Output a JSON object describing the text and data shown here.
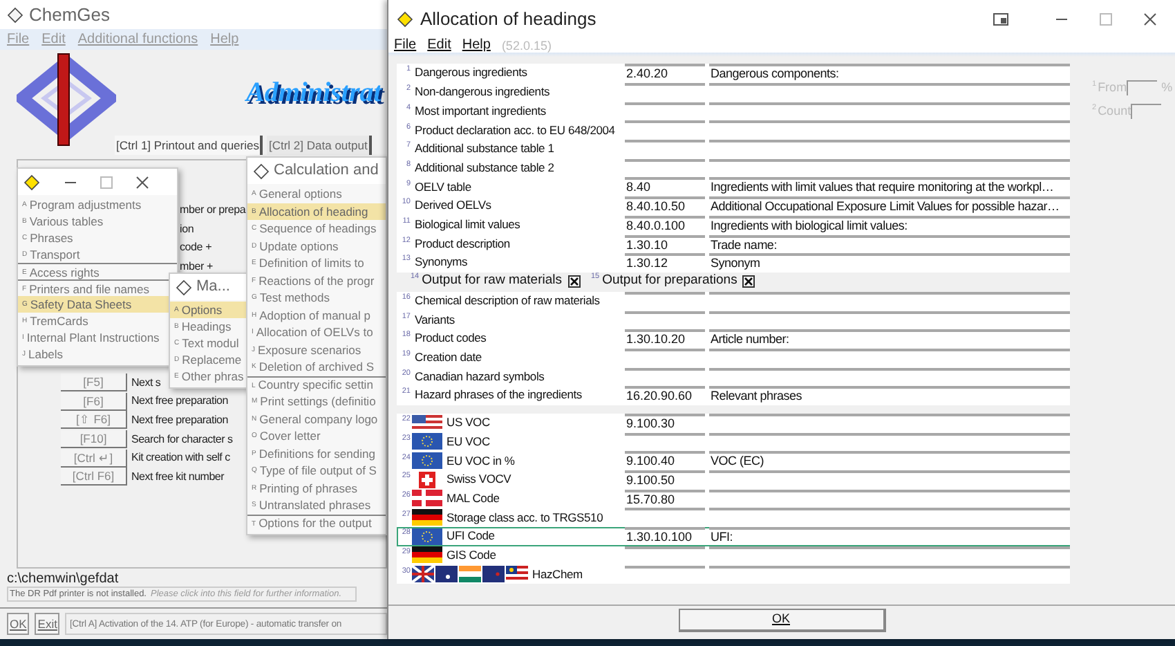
{
  "main_window": {
    "title": "ChemGes",
    "menu": [
      "File",
      "Edit",
      "Additional functions",
      "Help"
    ],
    "banner": "Administrat",
    "tabs": [
      {
        "label": "[Ctrl 1] Printout and queries",
        "selected": true
      },
      {
        "label": "[Ctrl 2] Data output",
        "selected": false
      }
    ],
    "partial_lines": [
      "mber or prepa",
      "ion",
      "code +",
      "mber +"
    ],
    "shortcuts": [
      {
        "key": "[F5]",
        "text": "Next s"
      },
      {
        "key": "[F6]",
        "text": "Next free preparation"
      },
      {
        "key": "[⇧ F6]",
        "text": "Next free preparation"
      },
      {
        "key": "[F10]",
        "text": "Search for character s"
      },
      {
        "key": "[Ctrl ↵]",
        "text": "Kit creation with self c"
      },
      {
        "key": "[Ctrl F6]",
        "text": "Next free kit number"
      }
    ],
    "path": "c:\\chemwin\\gefdat",
    "notice": {
      "text": "The DR Pdf printer is not installed.",
      "hint": "Please click into this field for further information."
    },
    "buttons": [
      "OK",
      "Exit"
    ],
    "status": "[Ctrl A] Activation of the 14. ATP (for Europe) - automatic transfer on"
  },
  "menus": [
    {
      "items": [
        {
          "letter": "A",
          "label": "Program adjustments",
          "selected": false,
          "separator_before": false
        },
        {
          "letter": "B",
          "label": "Various tables",
          "selected": false,
          "separator_before": false
        },
        {
          "letter": "C",
          "label": "Phrases",
          "selected": false,
          "separator_before": false
        },
        {
          "letter": "D",
          "label": "Transport",
          "selected": false,
          "separator_before": false
        },
        {
          "letter": "E",
          "label": "Access rights",
          "selected": false,
          "separator_before": true
        },
        {
          "letter": "F",
          "label": "Printers and file names",
          "selected": false,
          "separator_before": true
        },
        {
          "letter": "G",
          "label": "Safety Data Sheets",
          "selected": true,
          "separator_before": false
        },
        {
          "letter": "H",
          "label": "TremCards",
          "selected": false,
          "separator_before": false
        },
        {
          "letter": "I",
          "label": "Internal Plant Instructions",
          "selected": false,
          "separator_before": false
        },
        {
          "letter": "J",
          "label": "Labels",
          "selected": false,
          "separator_before": false
        }
      ]
    },
    {
      "title": "Ma...",
      "items": [
        {
          "letter": "A",
          "label": "Options",
          "selected": true,
          "separator_before": false
        },
        {
          "letter": "B",
          "label": "Headings",
          "selected": false,
          "separator_before": false
        },
        {
          "letter": "C",
          "label": "Text modul",
          "selected": false,
          "separator_before": false
        },
        {
          "letter": "D",
          "label": "Replaceme",
          "selected": false,
          "separator_before": false
        },
        {
          "letter": "E",
          "label": "Other phras",
          "selected": false,
          "separator_before": false
        }
      ]
    },
    {
      "title": "Calculation and",
      "items": [
        {
          "letter": "A",
          "label": "General options",
          "selected": false,
          "separator_before": false
        },
        {
          "letter": "B",
          "label": "Allocation of heading",
          "selected": true,
          "separator_before": false
        },
        {
          "letter": "C",
          "label": "Sequence of headings",
          "selected": false,
          "separator_before": false
        },
        {
          "letter": "D",
          "label": "Update options",
          "selected": false,
          "separator_before": false
        },
        {
          "letter": "E",
          "label": "Definition of limits to",
          "selected": false,
          "separator_before": false
        },
        {
          "letter": "F",
          "label": "Reactions of the progr",
          "selected": false,
          "separator_before": false
        },
        {
          "letter": "G",
          "label": "Test methods",
          "selected": false,
          "separator_before": false
        },
        {
          "letter": "H",
          "label": "Adoption of manual p",
          "selected": false,
          "separator_before": false
        },
        {
          "letter": "I",
          "label": "Allocation of OELVs to",
          "selected": false,
          "separator_before": false
        },
        {
          "letter": "J",
          "label": "Exposure scenarios",
          "selected": false,
          "separator_before": false
        },
        {
          "letter": "K",
          "label": "Deletion of archived S",
          "selected": false,
          "separator_before": false
        },
        {
          "letter": "L",
          "label": "Country specific settin",
          "selected": false,
          "separator_before": true
        },
        {
          "letter": "M",
          "label": "Print settings (definitio",
          "selected": false,
          "separator_before": false
        },
        {
          "letter": "N",
          "label": "General company logo",
          "selected": false,
          "separator_before": false
        },
        {
          "letter": "O",
          "label": "Cover letter",
          "selected": false,
          "separator_before": false
        },
        {
          "letter": "P",
          "label": "Definitions for sending",
          "selected": false,
          "separator_before": false
        },
        {
          "letter": "Q",
          "label": "Type of file output of S",
          "selected": false,
          "separator_before": false
        },
        {
          "letter": "R",
          "label": "Printing of phrases",
          "selected": false,
          "separator_before": false
        },
        {
          "letter": "S",
          "label": "Untranslated phrases",
          "selected": false,
          "separator_before": false
        },
        {
          "letter": "T",
          "label": "Options for the output",
          "selected": false,
          "separator_before": true
        }
      ]
    }
  ],
  "dialog": {
    "title": "Allocation of headings",
    "menu": [
      "File",
      "Edit",
      "Help"
    ],
    "version": "(52.0.15)",
    "rows": [
      {
        "kind": "field",
        "number": "1",
        "label": "Dangerous ingredients",
        "code": "2.40.20",
        "description": "Dangerous components:"
      },
      {
        "kind": "field",
        "number": "2",
        "label": "Non-dangerous ingredients"
      },
      {
        "kind": "field",
        "number": "4",
        "label": "Most important ingredients"
      },
      {
        "kind": "field",
        "number": "6",
        "label": "Product declaration acc. to EU 648/2004"
      },
      {
        "kind": "field",
        "number": "7",
        "label": "Additional substance table 1"
      },
      {
        "kind": "field",
        "number": "8",
        "label": "Additional substance table 2"
      },
      {
        "kind": "field",
        "number": "9",
        "label": "OELV table",
        "code": "8.40",
        "description": "Ingredients with limit values that require monitoring at the workpl…"
      },
      {
        "kind": "field",
        "number": "10",
        "label": "Derived OELVs",
        "code": "8.40.10.50",
        "description": "Additional Occupational Exposure Limit Values for possible hazar…"
      },
      {
        "kind": "field",
        "number": "11",
        "label": "Biological limit values",
        "code": "8.40.0.100",
        "description": "Ingredients with biological limit values:"
      },
      {
        "kind": "field",
        "number": "12",
        "label": "Product description",
        "code": "1.30.10",
        "description": "Trade name:"
      },
      {
        "kind": "field",
        "number": "13",
        "label": "Synonyms",
        "code": "1.30.12",
        "description": "Synonym"
      },
      {
        "kind": "checks",
        "checks": [
          {
            "number": "14",
            "label": "Output for raw materials",
            "checked": true
          },
          {
            "number": "15",
            "label": "Output for preparations",
            "checked": true
          }
        ]
      },
      {
        "kind": "field",
        "number": "16",
        "label": "Chemical description of raw materials"
      },
      {
        "kind": "field",
        "number": "17",
        "label": "Variants"
      },
      {
        "kind": "field",
        "number": "18",
        "label": "Product codes",
        "code": "1.30.10.20",
        "description": "Article number:"
      },
      {
        "kind": "field",
        "number": "19",
        "label": "Creation date"
      },
      {
        "kind": "field",
        "number": "20",
        "label": "Canadian hazard symbols"
      },
      {
        "kind": "field",
        "number": "21",
        "label": "Hazard phrases of the ingredients",
        "code": "16.20.90.60",
        "description": "Relevant phrases"
      }
    ],
    "flag_rows": [
      {
        "number": "22",
        "kind": "us",
        "label": "US VOC",
        "code": "9.100.30",
        "selected": false
      },
      {
        "number": "23",
        "kind": "eu",
        "label": "EU VOC",
        "selected": false
      },
      {
        "number": "24",
        "kind": "eu",
        "label": "EU VOC in %",
        "code": "9.100.40",
        "description": "VOC (EC)",
        "selected": false
      },
      {
        "number": "25",
        "kind": "ch",
        "label": "Swiss VOCV",
        "code": "9.100.50",
        "selected": false
      },
      {
        "number": "26",
        "kind": "dk",
        "label": "MAL Code",
        "code": "15.70.80",
        "selected": false
      },
      {
        "number": "27",
        "kind": "de",
        "label": "Storage class acc. to TRGS510",
        "selected": false
      },
      {
        "number": "28",
        "kind": "eu",
        "label": "UFI Code",
        "code": "1.30.10.100",
        "description": "UFI:",
        "selected": true
      },
      {
        "number": "29",
        "kind": "de",
        "label": "GIS Code",
        "selected": false
      },
      {
        "number": "30",
        "kind": "multi",
        "label": "HazChem",
        "selected": false
      }
    ],
    "side_fields": [
      {
        "number": "1",
        "label": "From",
        "unit": "%"
      },
      {
        "number": "2",
        "label": "Count"
      }
    ],
    "ok": "OK"
  }
}
